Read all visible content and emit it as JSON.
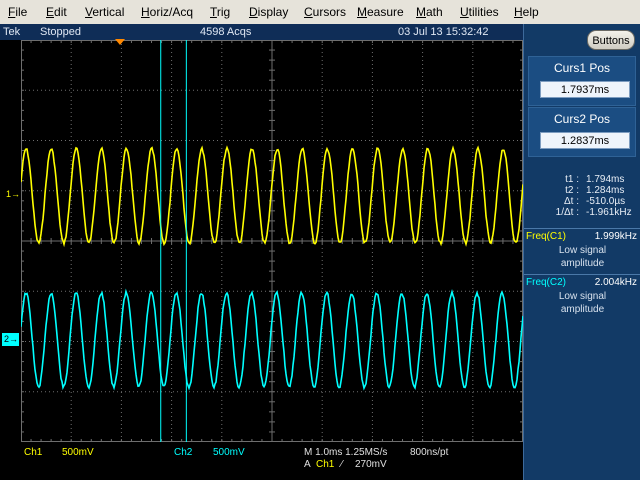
{
  "menu": {
    "items": [
      {
        "label": "File",
        "ul": "F",
        "rest": "ile"
      },
      {
        "label": "Edit",
        "ul": "E",
        "rest": "dit"
      },
      {
        "label": "Vertical",
        "ul": "V",
        "rest": "ertical"
      },
      {
        "label": "Horiz/Acq",
        "ul": "H",
        "rest": "oriz/Acq"
      },
      {
        "label": "Trig",
        "ul": "T",
        "rest": "rig"
      },
      {
        "label": "Display",
        "ul": "D",
        "rest": "isplay"
      },
      {
        "label": "Cursors",
        "ul": "C",
        "rest": "ursors"
      },
      {
        "label": "Measure",
        "ul": "M",
        "rest": "easure"
      },
      {
        "label": "Math",
        "ul": "M",
        "rest": "ath"
      },
      {
        "label": "Utilities",
        "ul": "U",
        "rest": "tilities"
      },
      {
        "label": "Help",
        "ul": "H",
        "rest": "elp"
      }
    ]
  },
  "status": {
    "brand": "Tek",
    "state": "Stopped",
    "acqs": "4598 Acqs",
    "datetime": "03 Jul 13 15:32:42"
  },
  "channels": {
    "ch1": {
      "marker": "1",
      "color": "#ffff00",
      "label": "Ch1",
      "scale": "500mV",
      "freq_khz": 1.999
    },
    "ch2": {
      "marker": "2",
      "color": "#00ffff",
      "label": "Ch2",
      "scale": "500mV",
      "freq_khz": 2.004
    }
  },
  "horizontal": {
    "timebase": "M 1.0ms 1.25MS/s",
    "resolution": "800ns/pt"
  },
  "trigger": {
    "prefix": "A",
    "source": "Ch1",
    "slope": "⁄",
    "level": "270mV"
  },
  "panel": {
    "buttons_label": "Buttons",
    "curs1": {
      "title": "Curs1 Pos",
      "value": "1.7937ms"
    },
    "curs2": {
      "title": "Curs2 Pos",
      "value": "1.2837ms"
    },
    "readout": [
      {
        "label": "t1 :",
        "value": "1.794ms"
      },
      {
        "label": "t2 :",
        "value": "1.284ms"
      },
      {
        "label": "Δt :",
        "value": "-510.0µs"
      },
      {
        "label": "1/Δt :",
        "value": "-1.961kHz"
      }
    ],
    "meas1": {
      "label": "Freq(C1)",
      "value": "1.999kHz",
      "note1": "Low signal",
      "note2": "amplitude"
    },
    "meas2": {
      "label": "Freq(C2)",
      "value": "2.004kHz",
      "note1": "Low signal",
      "note2": "amplitude"
    }
  },
  "cursors": {
    "time_ms": {
      "curs1": 1.7937,
      "curs2": 1.2837
    },
    "color": "#00ffff"
  },
  "colors": {
    "ch1": "#ffff00",
    "ch2": "#00ffff",
    "grid": "#6e6e6e",
    "trigger": "#ff8800",
    "panel_bg": "#123a66"
  }
}
